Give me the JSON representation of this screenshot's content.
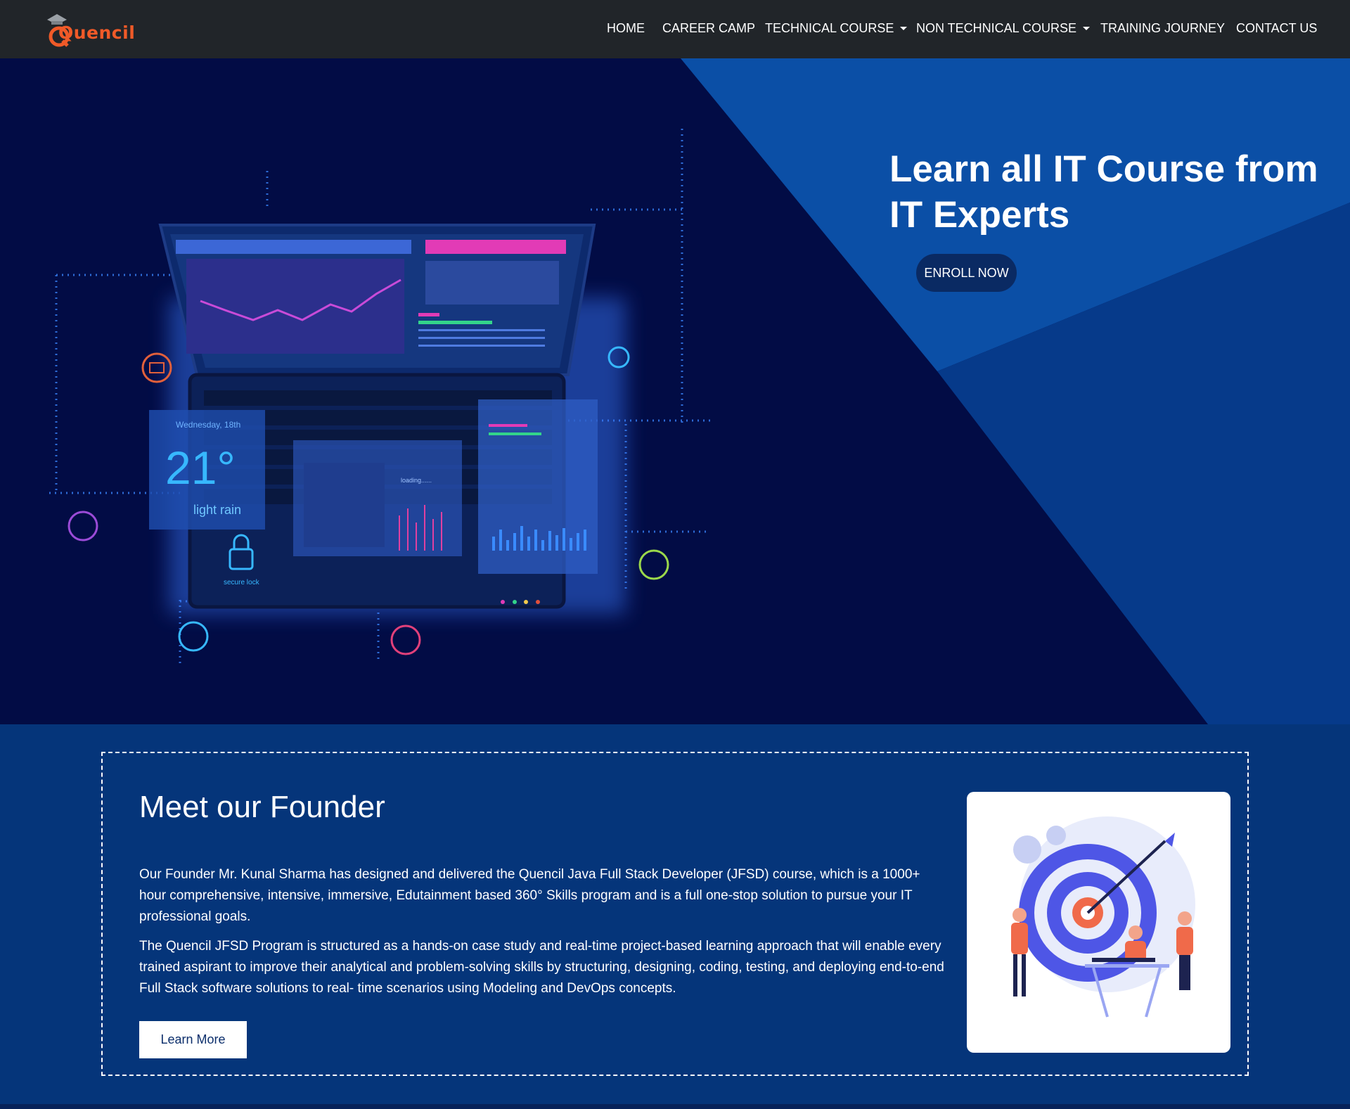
{
  "brand": {
    "logo_text": "Quencil",
    "accent": "#f05a28"
  },
  "nav": {
    "items": [
      {
        "label": "HOME"
      },
      {
        "label": "CAREER CAMP"
      },
      {
        "label": "TECHNICAL COURSE"
      },
      {
        "label": "NON TECHNICAL COURSE"
      },
      {
        "label": "TRAINING JOURNEY"
      },
      {
        "label": "CONTACT US"
      }
    ]
  },
  "hero": {
    "title": "Learn all IT Course from IT Experts",
    "cta_label": "ENROLL NOW",
    "illustration": {
      "date": "Wednesday, 18th",
      "temperature": "21°",
      "weather": "light rain",
      "lock_label": "secure lock",
      "loading": "loading......"
    }
  },
  "founder": {
    "title": "Meet our Founder",
    "paragraph1": "Our Founder Mr. Kunal Sharma has designed and delivered the Quencil Java Full Stack Developer (JFSD) course, which is a 1000+ hour comprehensive, intensive, immersive, Edutainment based 360° Skills program and is a full one-stop solution to pursue your IT professional goals.",
    "paragraph2": "The Quencil JFSD Program is structured as a hands-on case study and real-time project-based learning approach that will enable every trained aspirant to improve their analytical and problem-solving skills by structuring, designing, coding, testing, and deploying end-to-end Full Stack software solutions to real- time scenarios using Modeling and DevOps concepts.",
    "button_label": "Learn More"
  },
  "colors": {
    "navbar": "#212529",
    "hero_bg": "#020c45",
    "hero_accent": "#0b4fa6",
    "founder_bg": "#05357a"
  }
}
